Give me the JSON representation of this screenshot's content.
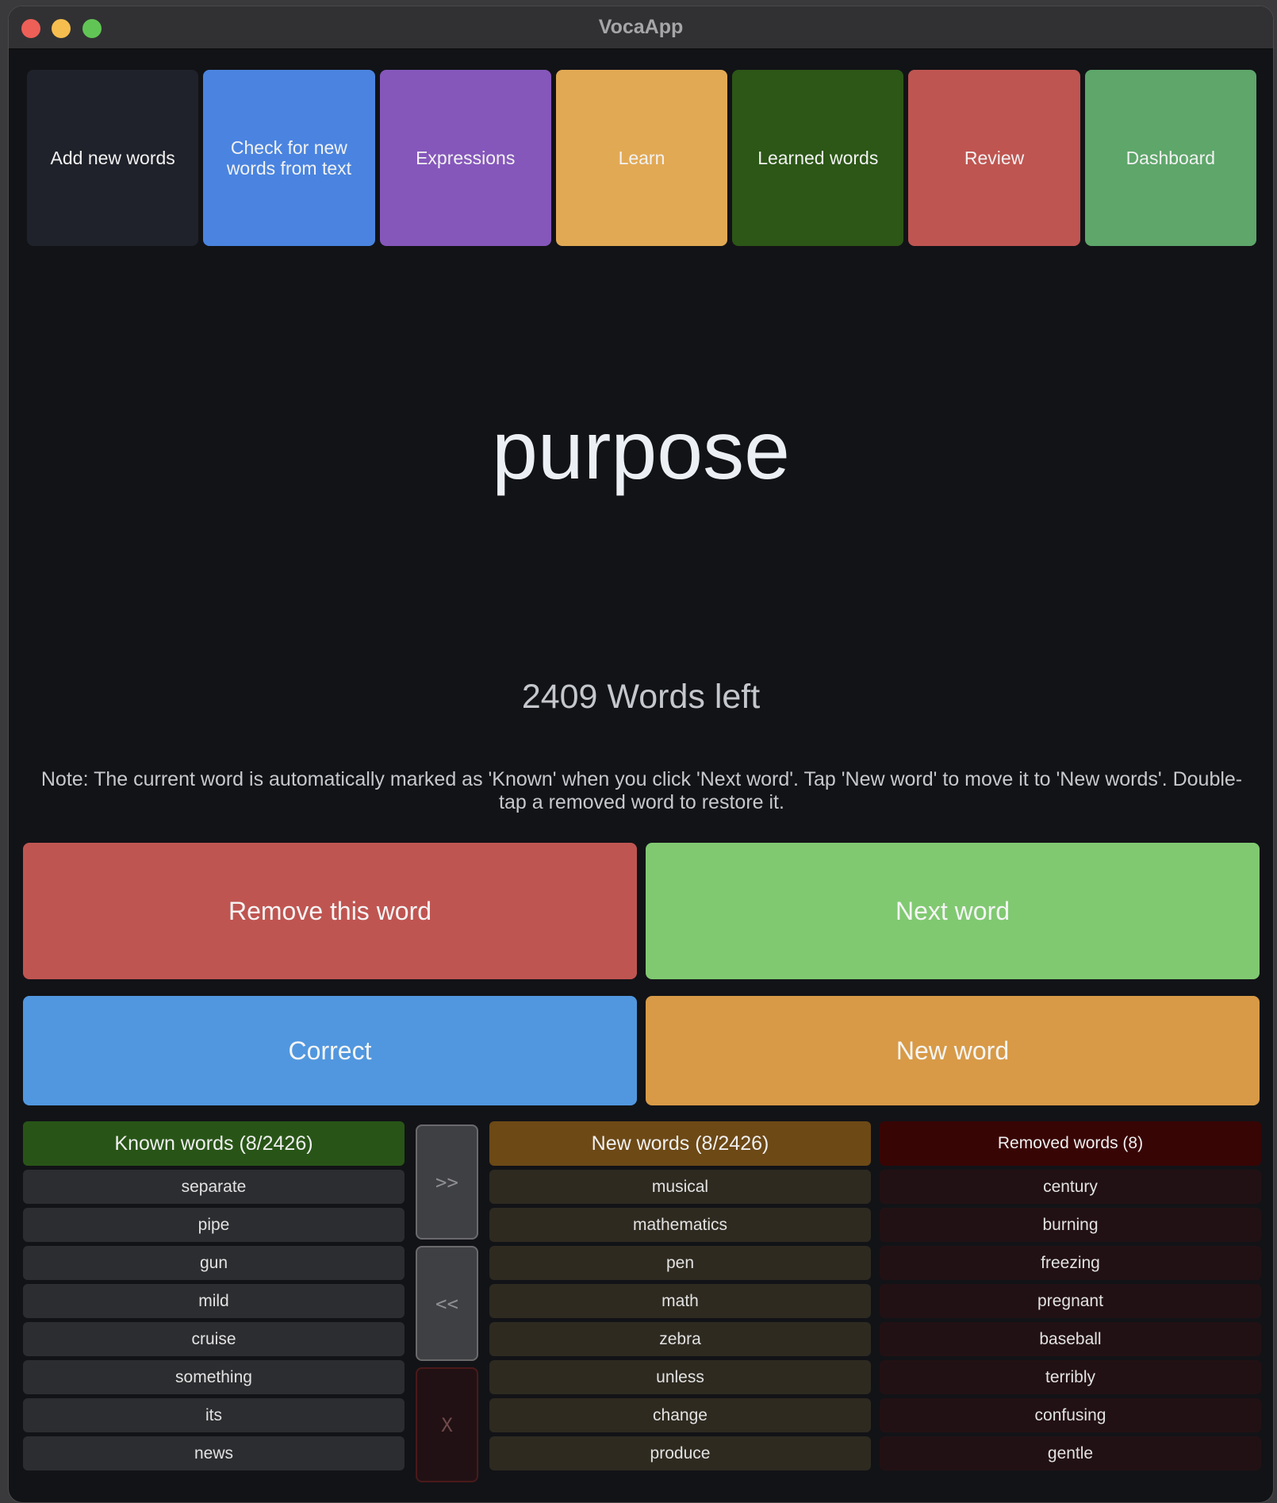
{
  "window": {
    "title": "VocaApp"
  },
  "nav": {
    "items": [
      {
        "label": "Add new words",
        "color": "#1f222a"
      },
      {
        "label": "Check for new words from text",
        "color": "#4a84e0"
      },
      {
        "label": "Expressions",
        "color": "#8557bb"
      },
      {
        "label": "Learn",
        "color": "#e2a954"
      },
      {
        "label": "Learned words",
        "color": "#2c5717"
      },
      {
        "label": "Review",
        "color": "#bf5551"
      },
      {
        "label": "Dashboard",
        "color": "#5ea66a"
      }
    ]
  },
  "current_word": "purpose",
  "words_left": "2409 Words left",
  "note": "Note: The current word is automatically marked as 'Known' when you click 'Next word'. Tap 'New word' to move it to 'New words'. Double-tap a removed word to restore it.",
  "actions": {
    "remove": {
      "label": "Remove this word",
      "color": "#bf5551"
    },
    "next": {
      "label": "Next word",
      "color": "#80c971"
    },
    "correct": {
      "label": "Correct",
      "color": "#5197df"
    },
    "new_word": {
      "label": "New word",
      "color": "#d89a47"
    }
  },
  "lists": {
    "known": {
      "title": "Known words (8/2426)",
      "items": [
        "separate",
        "pipe",
        "gun",
        "mild",
        "cruise",
        "something",
        "its",
        "news"
      ]
    },
    "new": {
      "title": "New words (8/2426)",
      "items": [
        "musical",
        "mathematics",
        "pen",
        "math",
        "zebra",
        "unless",
        "change",
        "produce"
      ]
    },
    "removed": {
      "title": "Removed words (8)",
      "items": [
        "century",
        "burning",
        "freezing",
        "pregnant",
        "baseball",
        "terribly",
        "confusing",
        "gentle"
      ]
    }
  },
  "transfer": {
    "to_new": ">>",
    "to_known": "<<",
    "remove": "X"
  }
}
